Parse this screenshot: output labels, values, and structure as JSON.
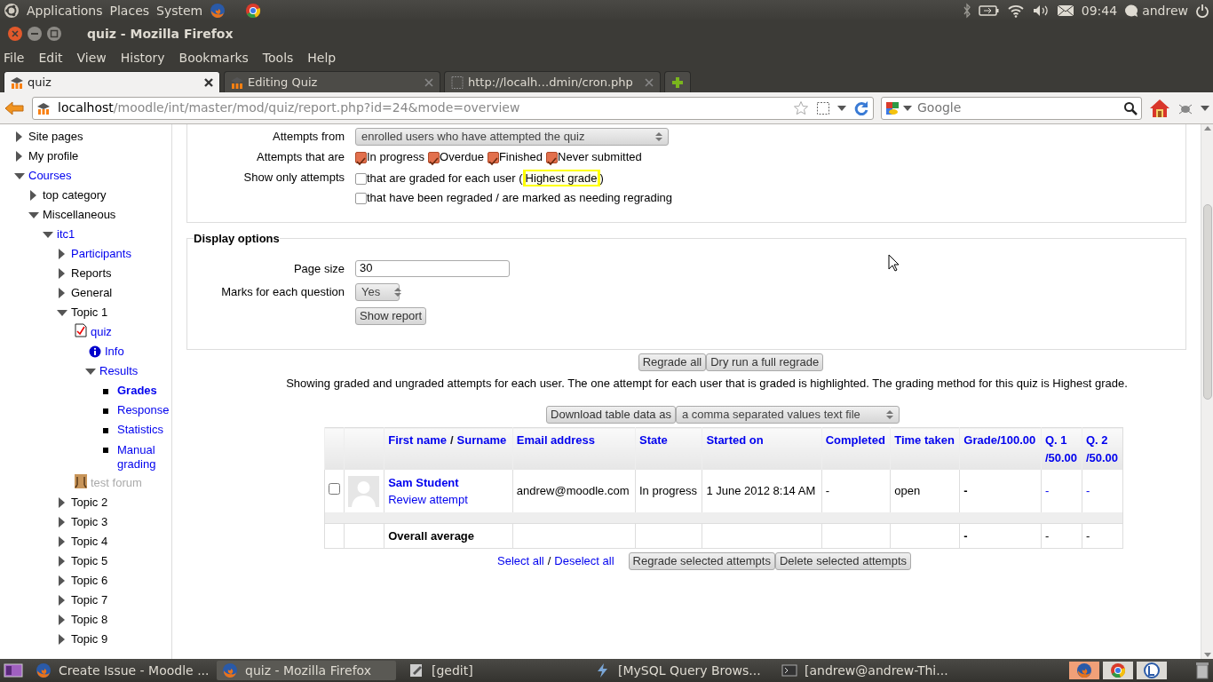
{
  "top_panel": {
    "menus": [
      "Applications",
      "Places",
      "System"
    ],
    "clock": "09:44",
    "user": "andrew"
  },
  "window": {
    "title": "quiz - Mozilla Firefox"
  },
  "menu_bar": [
    "File",
    "Edit",
    "View",
    "History",
    "Bookmarks",
    "Tools",
    "Help"
  ],
  "tabs": [
    {
      "label": "quiz",
      "selected": true
    },
    {
      "label": "Editing Quiz",
      "selected": false
    },
    {
      "label": "http://localh…dmin/cron.php",
      "selected": false
    }
  ],
  "address_bar": {
    "host": "localhost",
    "path": "/moodle/int/master/mod/quiz/report.php?id=24&mode=overview"
  },
  "search": {
    "placeholder": "Google"
  },
  "sidebar": {
    "items": [
      {
        "label": "Site pages",
        "kind": "category",
        "expanded": false
      },
      {
        "label": "My profile",
        "kind": "category",
        "expanded": false
      },
      {
        "label": "Courses",
        "kind": "link",
        "expanded": true,
        "children": [
          {
            "label": "top category",
            "kind": "category",
            "expanded": false
          },
          {
            "label": "Miscellaneous",
            "kind": "category",
            "expanded": true,
            "children": [
              {
                "label": "itc1",
                "kind": "link",
                "expanded": true,
                "children": [
                  {
                    "label": "Participants",
                    "kind": "link",
                    "expanded": false
                  },
                  {
                    "label": "Reports",
                    "kind": "category",
                    "expanded": false
                  },
                  {
                    "label": "General",
                    "kind": "category",
                    "expanded": false
                  },
                  {
                    "label": "Topic 1",
                    "kind": "category",
                    "expanded": true,
                    "children": [
                      {
                        "label": "quiz",
                        "kind": "quiz",
                        "children": [
                          {
                            "label": "Info",
                            "kind": "info"
                          },
                          {
                            "label": "Results",
                            "kind": "link",
                            "expanded": true,
                            "children": [
                              {
                                "label": "Grades",
                                "kind": "current"
                              },
                              {
                                "label": "Response",
                                "kind": "bullet"
                              },
                              {
                                "label": "Statistics",
                                "kind": "bullet"
                              },
                              {
                                "label": "Manual grading",
                                "kind": "bullet"
                              }
                            ]
                          }
                        ]
                      },
                      {
                        "label": "test forum",
                        "kind": "hidden-forum"
                      }
                    ]
                  },
                  {
                    "label": "Topic 2",
                    "kind": "category",
                    "expanded": false
                  },
                  {
                    "label": "Topic 3",
                    "kind": "category",
                    "expanded": false
                  },
                  {
                    "label": "Topic 4",
                    "kind": "category",
                    "expanded": false
                  },
                  {
                    "label": "Topic 5",
                    "kind": "category",
                    "expanded": false
                  },
                  {
                    "label": "Topic 6",
                    "kind": "category",
                    "expanded": false
                  },
                  {
                    "label": "Topic 7",
                    "kind": "category",
                    "expanded": false
                  },
                  {
                    "label": "Topic 8",
                    "kind": "category",
                    "expanded": false
                  },
                  {
                    "label": "Topic 9",
                    "kind": "category",
                    "expanded": false
                  }
                ]
              }
            ]
          }
        ]
      }
    ]
  },
  "attempts_from": {
    "label": "Attempts from",
    "value": "enrolled users who have attempted the quiz"
  },
  "attempt_states": {
    "label": "Attempts that are",
    "options": [
      {
        "label": "In progress",
        "checked": true
      },
      {
        "label": "Overdue",
        "checked": true
      },
      {
        "label": "Finished",
        "checked": true
      },
      {
        "label": "Never submitted",
        "checked": true
      }
    ]
  },
  "show_only": {
    "label": "Show only attempts",
    "options": [
      {
        "label": "that are graded for each user (",
        "highlight": "Highest grade",
        "suffix": ")",
        "checked": false
      },
      {
        "label": "that have been regraded / are marked as needing regrading",
        "checked": false
      }
    ]
  },
  "display_options": {
    "legend": "Display options",
    "page_size": {
      "label": "Page size",
      "value": "30"
    },
    "marks": {
      "label": "Marks for each question",
      "value": "Yes"
    },
    "submit": "Show report"
  },
  "regrade_buttons": [
    "Regrade all",
    "Dry run a full regrade"
  ],
  "summary": "Showing graded and ungraded attempts for each user. The one attempt for each user that is graded is highlighted. The grading method for this quiz is Highest grade.",
  "download": {
    "button": "Download table data as",
    "format": "a comma separated values text file"
  },
  "table": {
    "name_column": {
      "first": "First name",
      "separator": "/",
      "last": "Surname"
    },
    "columns": [
      "Email address",
      "State",
      "Started on",
      "Completed",
      "Time taken",
      "Grade/100.00",
      "Q. 1\n/50.00",
      "Q. 2\n/50.00"
    ],
    "rows": [
      {
        "checked": false,
        "name": "Sam Student",
        "review": "Review attempt",
        "cells": [
          {
            "text": "andrew@moodle.com",
            "kind": "text"
          },
          {
            "text": "In progress",
            "kind": "text"
          },
          {
            "text": "1 June 2012 8:14 AM",
            "kind": "text"
          },
          {
            "text": "-",
            "kind": "text"
          },
          {
            "text": "open",
            "kind": "text"
          },
          {
            "text": "-",
            "kind": "bold"
          },
          {
            "text": "-",
            "kind": "link"
          },
          {
            "text": "-",
            "kind": "link"
          }
        ]
      }
    ],
    "average": {
      "label": "Overall average",
      "grade": "-",
      "questions": [
        "-",
        "-"
      ]
    }
  },
  "selection_links": {
    "select": "Select all",
    "separator": "/",
    "deselect": "Deselect all"
  },
  "bulk_buttons": [
    "Regrade selected attempts",
    "Delete selected attempts"
  ],
  "taskbar": {
    "items": [
      {
        "label": "Create Issue - Moodle ...",
        "kind": "firefox",
        "selected": false
      },
      {
        "label": "quiz - Mozilla Firefox",
        "kind": "firefox",
        "selected": true
      },
      {
        "label": "[gedit]",
        "kind": "editor",
        "selected": false
      },
      {
        "label": "[MySQL Query Brows...",
        "kind": "database",
        "selected": false
      },
      {
        "label": "[andrew@andrew-Thi...",
        "kind": "terminal",
        "selected": false
      }
    ]
  }
}
